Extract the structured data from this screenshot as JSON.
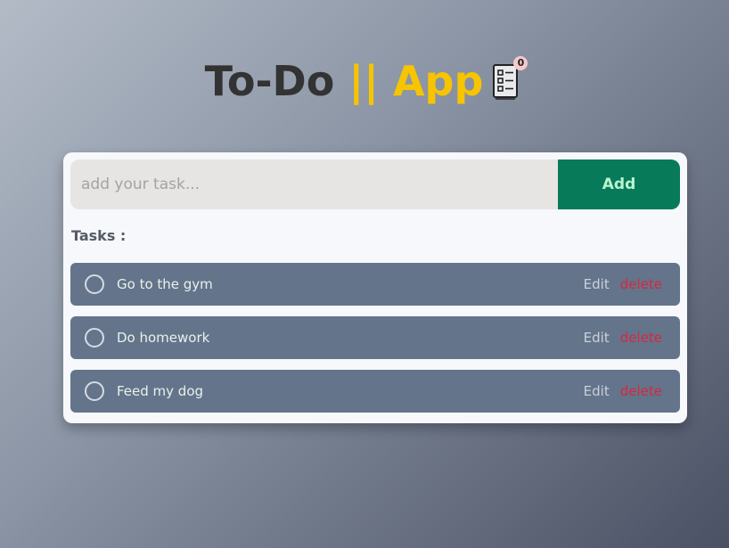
{
  "header": {
    "title_part1": "To-Do ",
    "title_part2": "|| App",
    "icon": "checklist-icon",
    "badge_count": "0"
  },
  "form": {
    "placeholder": "add your task...",
    "value": "",
    "add_label": "Add"
  },
  "tasks_label": "Tasks :",
  "tasks": [
    {
      "text": "Go to the gym",
      "edit_label": "Edit",
      "delete_label": "delete"
    },
    {
      "text": "Do homework",
      "edit_label": "Edit",
      "delete_label": "delete"
    },
    {
      "text": "Feed my dog",
      "edit_label": "Edit",
      "delete_label": "delete"
    }
  ],
  "colors": {
    "title_dark": "#333333",
    "title_accent": "#f7c400",
    "add_button_bg": "#077a5a",
    "add_button_text": "#b9f5cf",
    "task_bg": "#64748b",
    "delete_text": "#d8273f"
  }
}
